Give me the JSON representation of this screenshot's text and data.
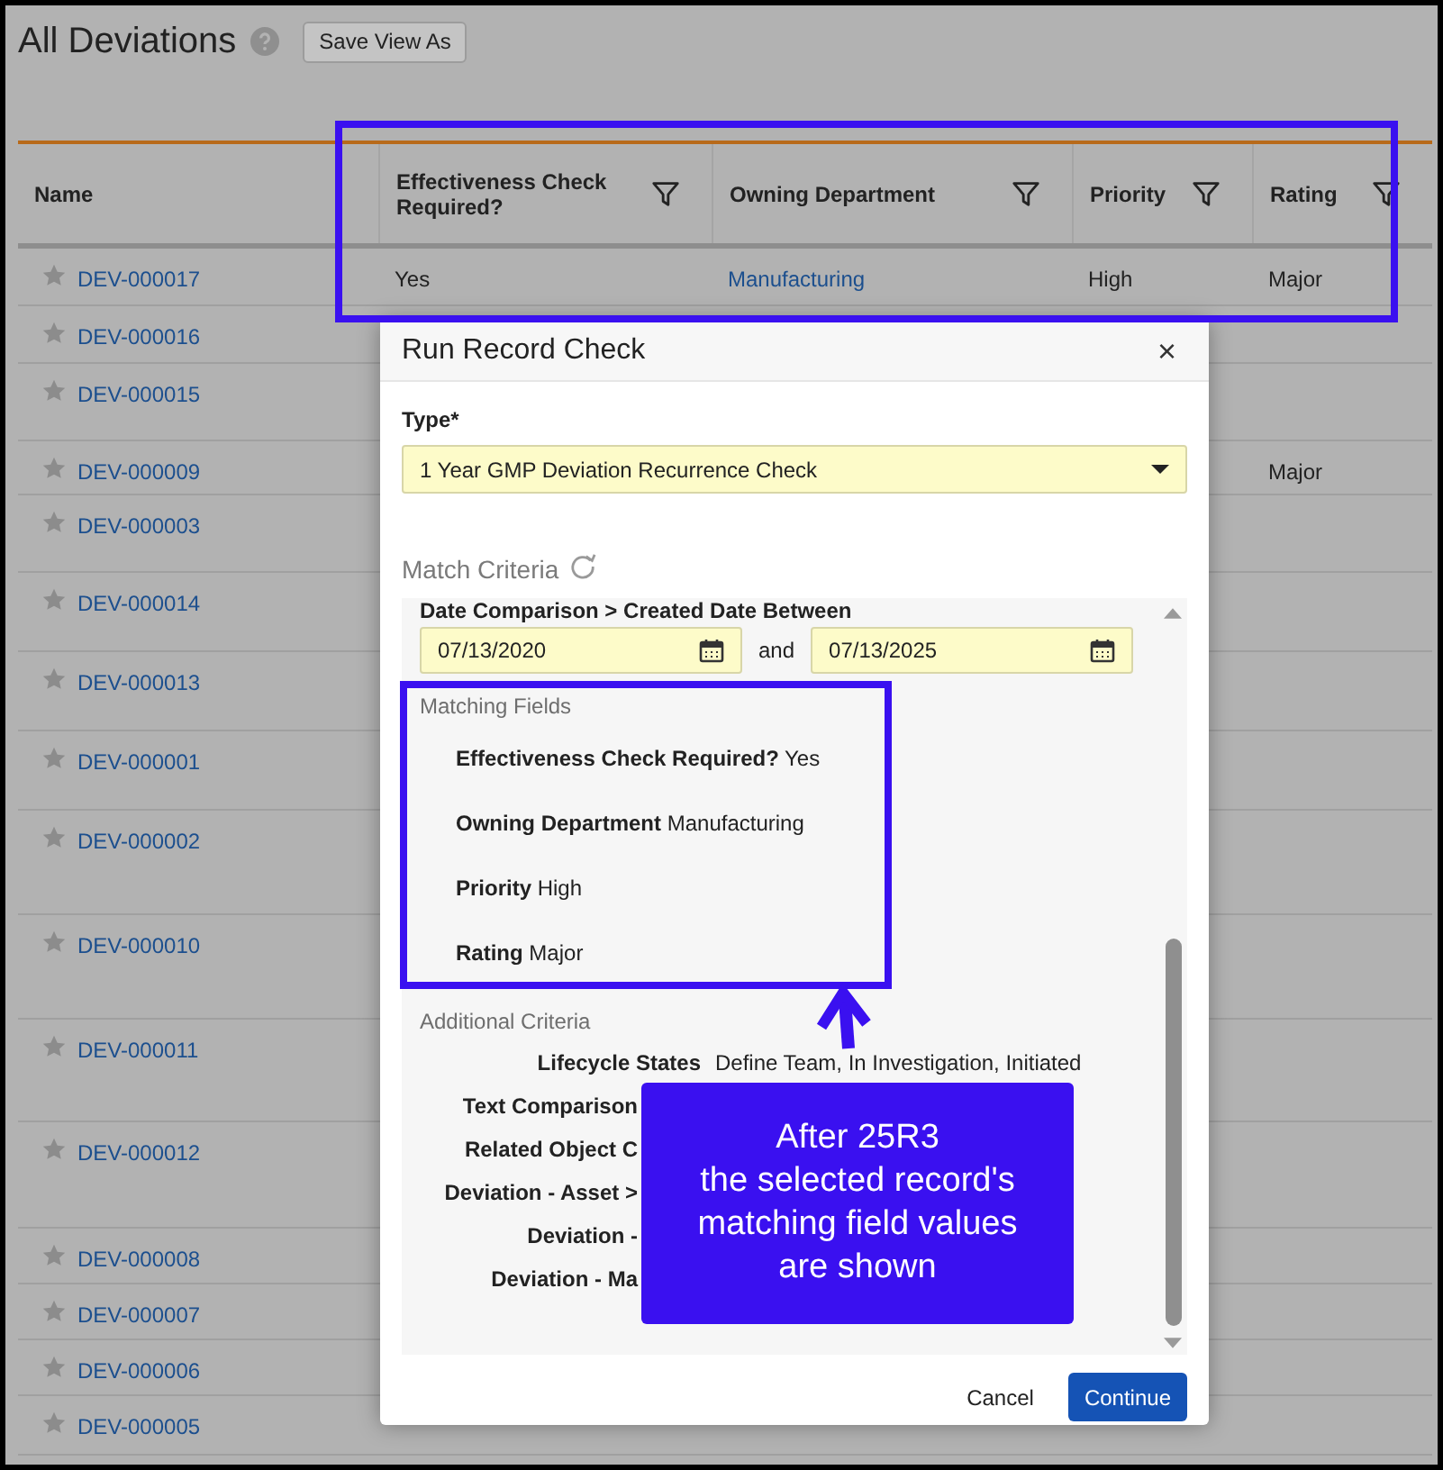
{
  "page": {
    "title": "All Deviations",
    "save_view_button": "Save View As"
  },
  "table": {
    "columns": [
      {
        "label": "Name",
        "filter": false
      },
      {
        "label": "Effectiveness Check Required?",
        "filter": true
      },
      {
        "label": "Owning Department",
        "filter": true
      },
      {
        "label": "Priority",
        "filter": true
      },
      {
        "label": "Rating",
        "filter": true
      }
    ],
    "rows": [
      {
        "name": "DEV-000017",
        "effectiveness_check_required": "Yes",
        "owning_department": "Manufacturing",
        "priority": "High",
        "rating": "Major"
      },
      {
        "name": "DEV-000016"
      },
      {
        "name": "DEV-000015"
      },
      {
        "name": "DEV-000009",
        "rating": "Major"
      },
      {
        "name": "DEV-000003"
      },
      {
        "name": "DEV-000014"
      },
      {
        "name": "DEV-000013"
      },
      {
        "name": "DEV-000001"
      },
      {
        "name": "DEV-000002"
      },
      {
        "name": "DEV-000010"
      },
      {
        "name": "DEV-000011"
      },
      {
        "name": "DEV-000012"
      },
      {
        "name": "DEV-000008"
      },
      {
        "name": "DEV-000007"
      },
      {
        "name": "DEV-000006"
      },
      {
        "name": "DEV-000005"
      }
    ]
  },
  "dialog": {
    "title": "Run Record Check",
    "close": "×",
    "type_label": "Type*",
    "type_value": "1 Year GMP Deviation Recurrence Check",
    "match_criteria": "Match Criteria",
    "date_comparison": {
      "label": "Date Comparison > Created Date Between",
      "from": "07/13/2020",
      "joiner": "and",
      "to": "07/13/2025"
    },
    "matching_fields_heading": "Matching Fields",
    "matching_fields": [
      {
        "label": "Effectiveness Check Required?",
        "value": "Yes"
      },
      {
        "label": "Owning Department",
        "value": "Manufacturing"
      },
      {
        "label": "Priority",
        "value": "High"
      },
      {
        "label": "Rating",
        "value": "Major"
      }
    ],
    "additional_criteria_heading": "Additional Criteria",
    "additional_criteria": [
      {
        "label": "Lifecycle States",
        "value": "Define Team, In Investigation, Initiated"
      },
      {
        "label": "Text Comparison"
      },
      {
        "label": "Related Object C"
      },
      {
        "label": "Deviation - Asset >"
      },
      {
        "label": "Deviation -"
      },
      {
        "label": "Deviation - Ma"
      }
    ],
    "buttons": {
      "cancel": "Cancel",
      "continue": "Continue"
    }
  },
  "callout": {
    "lines": [
      "After 25R3",
      "the selected record's",
      "matching field values",
      "are shown"
    ]
  }
}
